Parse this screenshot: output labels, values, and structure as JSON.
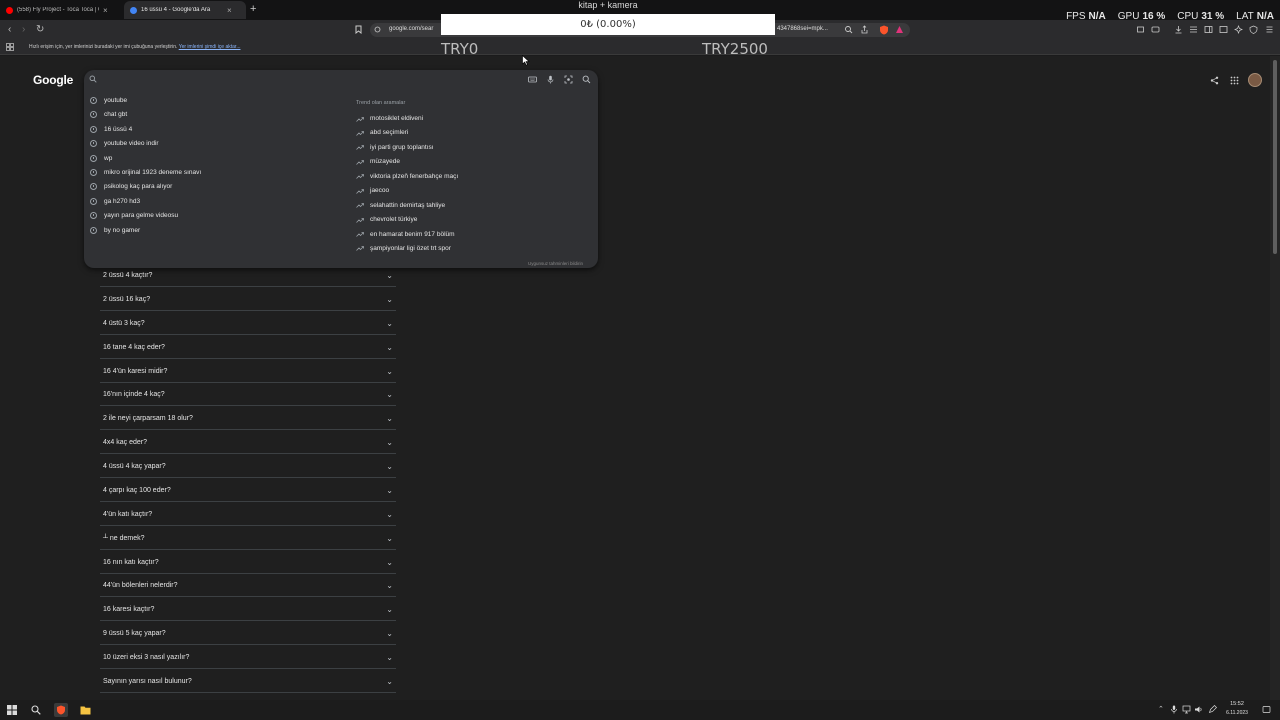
{
  "browser": {
    "tabs": [
      {
        "title": "(558) Fly Project - Toca Toca | Offi",
        "favicon_color": "#ff0000"
      },
      {
        "title": "16 üssü 4 - Google'da Ara",
        "favicon_color": "#4285f4"
      }
    ],
    "url_left": "google.com/sear",
    "url_right": "4347868sei=mpk...",
    "bookmark_bar_text": "Hızlı erişim için, yer imlerinizi buradaki yer imi çubuğuna yerleştirin.",
    "bookmark_bar_link": "Yer imlerini şimdi içe aktar..."
  },
  "overlay": {
    "label": "kitap + kamera",
    "progress_text": "0₺ (0.00%)",
    "progress_fraction": 0.0,
    "left_amount": "TRY0",
    "right_amount": "TRY2500"
  },
  "stats": {
    "fps_label": "FPS",
    "fps_value": "N/A",
    "gpu_label": "GPU",
    "gpu_value": "16 %",
    "cpu_label": "CPU",
    "cpu_value": "31 %",
    "lat_label": "LAT",
    "lat_value": "N/A"
  },
  "google": {
    "logo": "Google",
    "search_value": "",
    "history": [
      "youtube",
      "chat gbt",
      "16 üssü 4",
      "youtube video indir",
      "wp",
      "mikro orijinal 1923 deneme sınavı",
      "psikolog kaç para alıyor",
      "ga h270 hd3",
      "yayın para gelme videosu",
      "by no gamer"
    ],
    "trending_header": "Trend olan aramalar",
    "trending": [
      "motosiklet eldiveni",
      "abd seçimleri",
      "iyi parti grup toplantısı",
      "müzayede",
      "viktoria plzeň fenerbahçe maçı",
      "jaecoo",
      "selahattin demirtaş tahliye",
      "chevrolet türkiye",
      "en hamarat benim 917 bölüm",
      "şampiyonlar ligi özet trt spor"
    ],
    "report_text": "Uygunsuz tahminleri bildirin",
    "questions": [
      "2 üssü 4 kaçtır?",
      "2 üssü 16 kaç?",
      "4 üstü 3 kaç?",
      "16 tane 4 kaç eder?",
      "16 4'ün karesi midir?",
      "16'nın içinde 4 kaç?",
      "2 ile neyi çarparsam 18 olur?",
      "4x4 kaç eder?",
      "4 üssü 4 kaç yapar?",
      "4 çarpı kaç 100 eder?",
      "4'ün katı kaçtır?",
      "┴ ne demek?",
      "16 nın katı kaçtır?",
      "44'ün bölenleri nelerdir?",
      "16 karesi kaçtır?",
      "9 üssü 5 kaç yapar?",
      "10 üzeri eksi 3 nasıl yazılır?",
      "Sayının yarısı nasıl bulunur?"
    ]
  },
  "taskbar": {
    "time": "15:52",
    "date": "6.11.2023"
  },
  "colors": {
    "page_bg": "#1f1f1f",
    "panel_bg": "#303134",
    "link": "#8ab4f8"
  }
}
